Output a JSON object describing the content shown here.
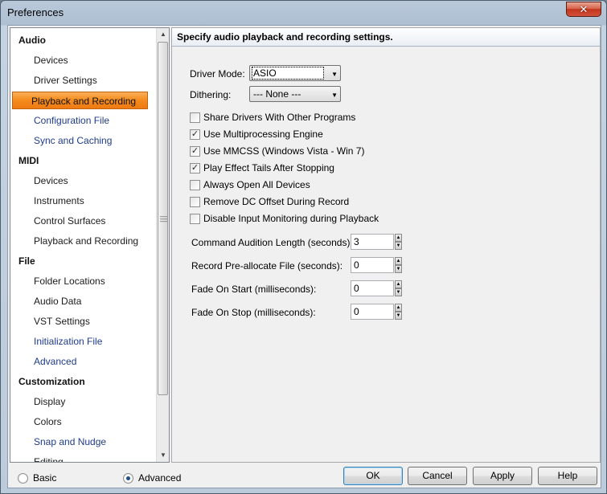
{
  "window": {
    "title": "Preferences"
  },
  "tree": {
    "items": [
      {
        "label": "Audio",
        "kind": "category"
      },
      {
        "label": "Devices",
        "kind": "leaf"
      },
      {
        "label": "Driver Settings",
        "kind": "leaf"
      },
      {
        "label": "Playback and Recording",
        "kind": "leaf",
        "selected": true
      },
      {
        "label": "Configuration File",
        "kind": "link"
      },
      {
        "label": "Sync and Caching",
        "kind": "link"
      },
      {
        "label": "MIDI",
        "kind": "category"
      },
      {
        "label": "Devices",
        "kind": "leaf"
      },
      {
        "label": "Instruments",
        "kind": "leaf"
      },
      {
        "label": "Control Surfaces",
        "kind": "leaf"
      },
      {
        "label": "Playback and Recording",
        "kind": "leaf"
      },
      {
        "label": "File",
        "kind": "category"
      },
      {
        "label": "Folder Locations",
        "kind": "leaf"
      },
      {
        "label": "Audio Data",
        "kind": "leaf"
      },
      {
        "label": "VST Settings",
        "kind": "leaf"
      },
      {
        "label": "Initialization File",
        "kind": "link"
      },
      {
        "label": "Advanced",
        "kind": "link"
      },
      {
        "label": "Customization",
        "kind": "category"
      },
      {
        "label": "Display",
        "kind": "leaf"
      },
      {
        "label": "Colors",
        "kind": "leaf"
      },
      {
        "label": "Snap and Nudge",
        "kind": "link"
      },
      {
        "label": "Editing",
        "kind": "leaf"
      }
    ]
  },
  "panel": {
    "header": "Specify audio playback and recording settings.",
    "driver_mode": {
      "label": "Driver Mode:",
      "value": "ASIO"
    },
    "dithering": {
      "label": "Dithering:",
      "value": "--- None ---"
    },
    "checkboxes": [
      {
        "label": "Share Drivers With Other Programs",
        "checked": false
      },
      {
        "label": "Use Multiprocessing Engine",
        "checked": true
      },
      {
        "label": "Use MMCSS (Windows Vista - Win 7)",
        "checked": true
      },
      {
        "label": "Play Effect Tails After Stopping",
        "checked": true
      },
      {
        "label": "Always Open All Devices",
        "checked": false
      },
      {
        "label": "Remove DC Offset During Record",
        "checked": false
      },
      {
        "label": "Disable Input Monitoring during Playback",
        "checked": false
      }
    ],
    "numeric_fields": [
      {
        "label": "Command Audition Length (seconds):",
        "value": "3"
      },
      {
        "label": "Record Pre-allocate File (seconds):",
        "value": "0"
      },
      {
        "label": "Fade On Start  (milliseconds):",
        "value": "0"
      },
      {
        "label": "Fade On Stop  (milliseconds):",
        "value": "0"
      }
    ]
  },
  "footer": {
    "view_mode": {
      "basic": "Basic",
      "advanced": "Advanced",
      "selected": "Advanced"
    },
    "buttons": {
      "ok": "OK",
      "cancel": "Cancel",
      "apply": "Apply",
      "help": "Help"
    }
  },
  "icons": {
    "close": "close-icon",
    "check": "checkmark-icon",
    "dropdown": "chevron-down-icon",
    "spin_up": "arrow-up-icon",
    "spin_down": "arrow-down-icon"
  }
}
